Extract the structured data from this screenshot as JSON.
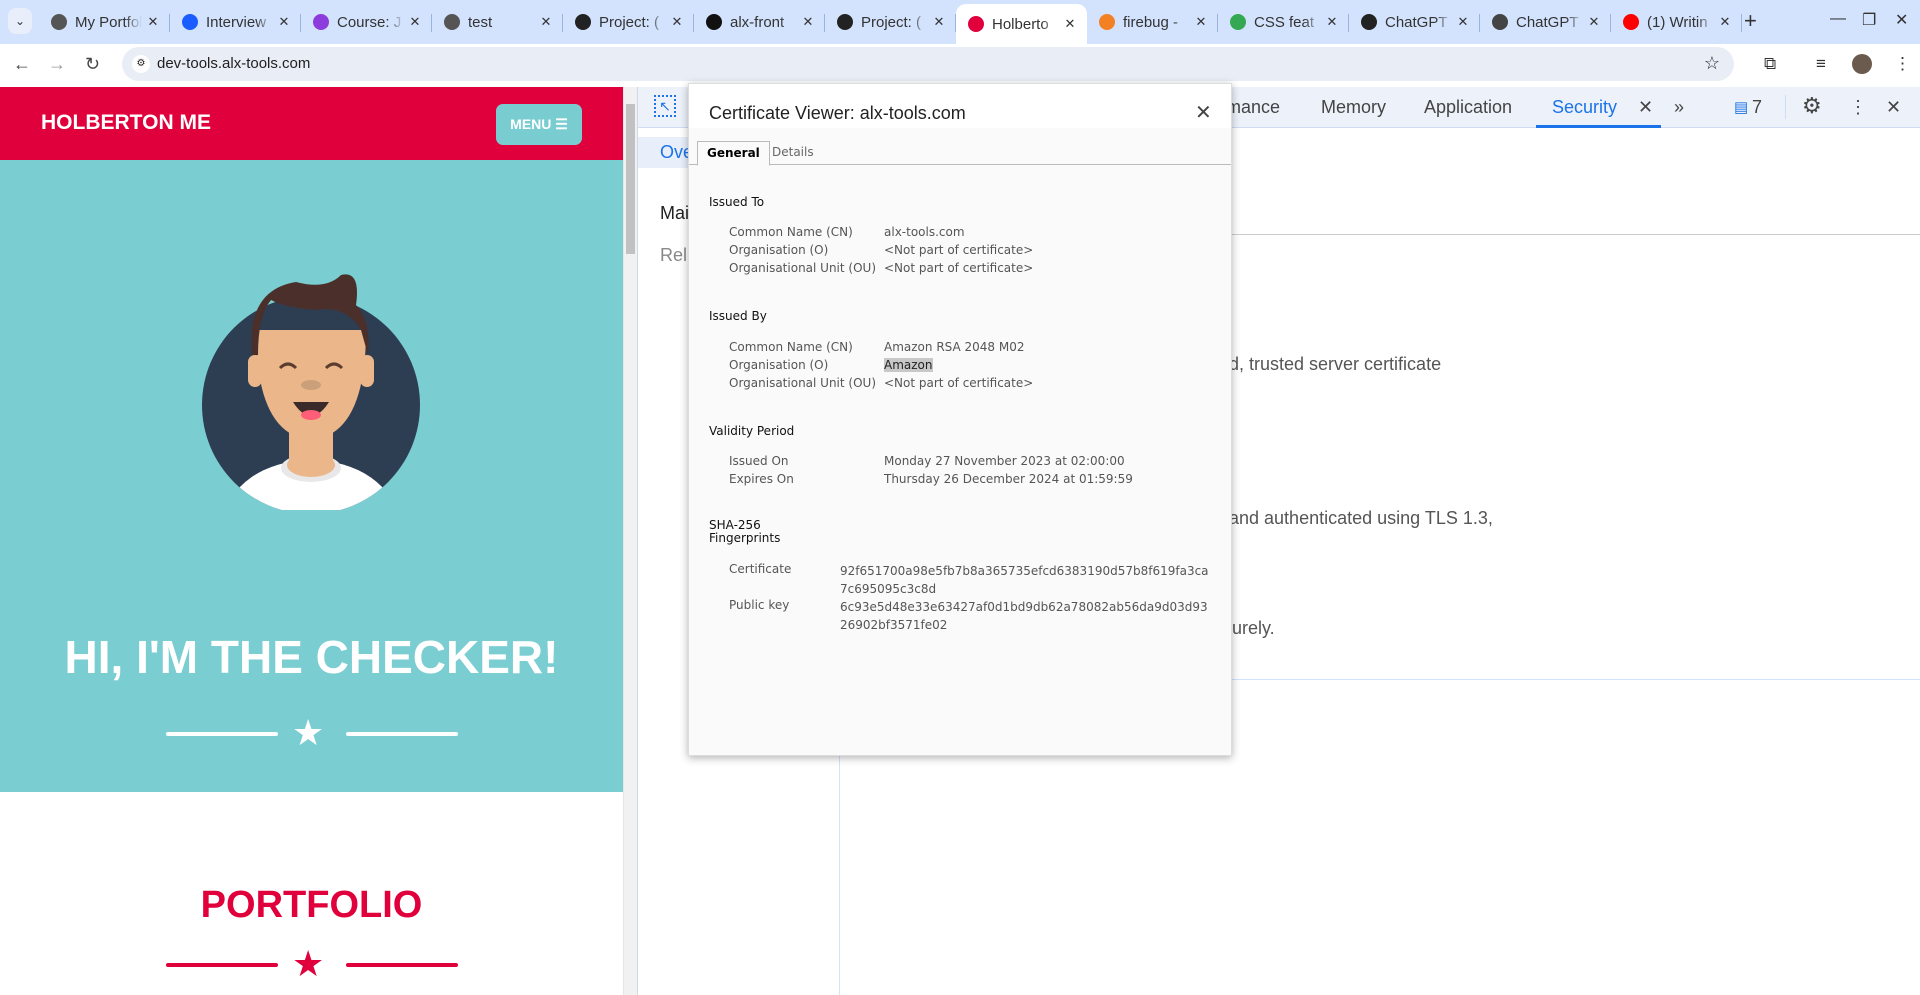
{
  "browser": {
    "tabs": [
      {
        "title": "My Portfolio",
        "favicon": "alx-icon",
        "color": "#555"
      },
      {
        "title": "Interview",
        "favicon": "c-logo-icon",
        "color": "#1a5cff"
      },
      {
        "title": "Course: J",
        "favicon": "u-logo-icon",
        "color": "#8c3cdd"
      },
      {
        "title": "test",
        "favicon": "globe-icon",
        "color": "#555"
      },
      {
        "title": "Project: (",
        "favicon": "alx-icon",
        "color": "#222"
      },
      {
        "title": "alx-front",
        "favicon": "github-icon",
        "color": "#111"
      },
      {
        "title": "Project: (",
        "favicon": "alx-icon",
        "color": "#222"
      },
      {
        "title": "Holberto",
        "favicon": "holberton-icon",
        "color": "#e0003b",
        "active": true
      },
      {
        "title": "firebug -",
        "favicon": "stackoverflow-icon",
        "color": "#f48024"
      },
      {
        "title": "CSS feat",
        "favicon": "chrome-icon",
        "color": "#34a853"
      },
      {
        "title": "ChatGPT",
        "favicon": "chatgpt-icon",
        "color": "#222"
      },
      {
        "title": "ChatGPT",
        "favicon": "openai-icon",
        "color": "#444"
      },
      {
        "title": "(1) Writin",
        "favicon": "youtube-icon",
        "color": "#ff0000"
      }
    ],
    "url": "dev-tools.alx-tools.com"
  },
  "site": {
    "brand": "HOLBERTON ME",
    "menu_label": "MENU ☰",
    "hero_heading": "HI, I'M THE CHECKER!",
    "portfolio_heading": "PORTFOLIO",
    "colors": {
      "red": "#e0003b",
      "teal": "#7acdd1"
    }
  },
  "devtools": {
    "tabs": [
      "mance",
      "Memory",
      "Application",
      "Security"
    ],
    "active_tab": "Security",
    "issues_count": "7",
    "sidebar": [
      "Ove",
      "Mai",
      "Rel"
    ],
    "main_fragments": [
      "d, trusted server certificate",
      "and authenticated using TLS 1.3,",
      "urely."
    ]
  },
  "cert": {
    "title": "Certificate Viewer: alx-tools.com",
    "tabs": [
      "General",
      "Details"
    ],
    "issued_to": {
      "heading": "Issued To",
      "rows": [
        {
          "k": "Common Name (CN)",
          "v": "alx-tools.com"
        },
        {
          "k": "Organisation (O)",
          "v": "<Not part of certificate>"
        },
        {
          "k": "Organisational Unit (OU)",
          "v": "<Not part of certificate>"
        }
      ]
    },
    "issued_by": {
      "heading": "Issued By",
      "rows": [
        {
          "k": "Common Name (CN)",
          "v": "Amazon RSA 2048 M02"
        },
        {
          "k": "Organisation (O)",
          "v": "Amazon"
        },
        {
          "k": "Organisational Unit (OU)",
          "v": "<Not part of certificate>"
        }
      ]
    },
    "validity": {
      "heading": "Validity Period",
      "rows": [
        {
          "k": "Issued On",
          "v": "Monday 27 November 2023 at 02:00:00"
        },
        {
          "k": "Expires On",
          "v": "Thursday 26 December 2024 at 01:59:59"
        }
      ]
    },
    "fingerprints": {
      "heading_1": "SHA-256",
      "heading_2": "Fingerprints",
      "rows": [
        {
          "k": "Certificate",
          "v": "92f651700a98e5fb7b8a365735efcd6383190d57b8f619fa3ca7c695095c3c8d"
        },
        {
          "k": "Public key",
          "v": "6c93e5d48e33e63427af0d1bd9db62a78082ab56da9d03d9326902bf3571fe02"
        }
      ]
    }
  }
}
